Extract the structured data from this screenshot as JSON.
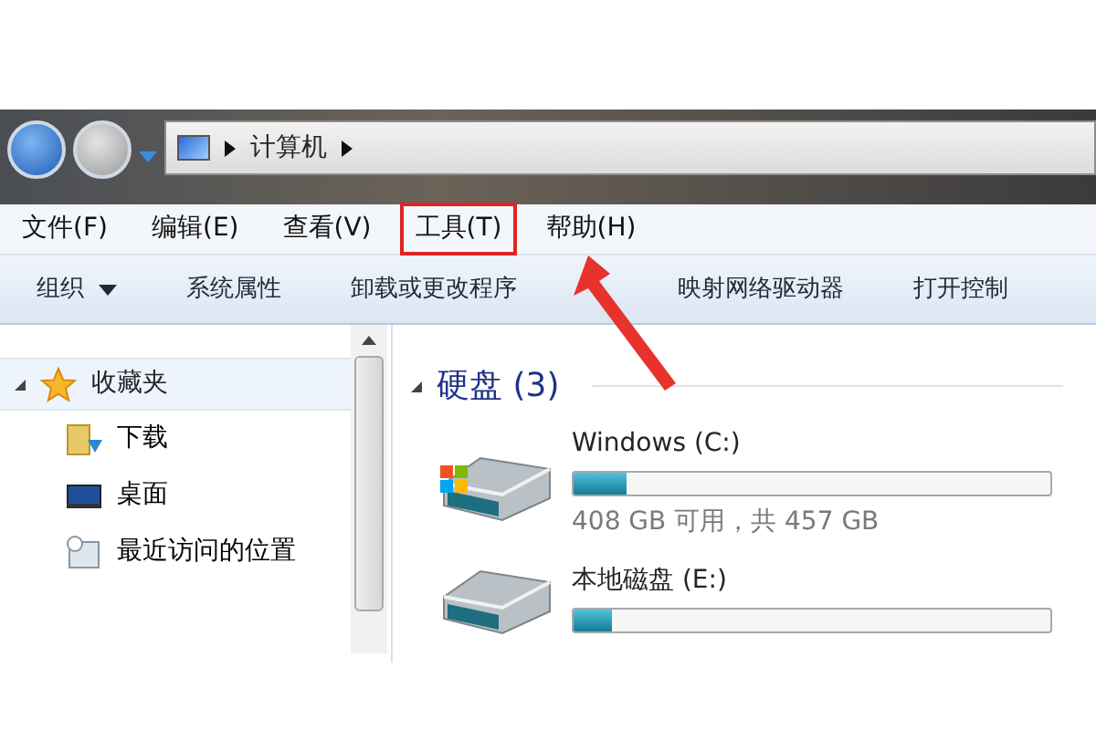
{
  "address_bar": {
    "crumbs": [
      "计算机"
    ]
  },
  "menu": [
    {
      "label": "文件(F)",
      "highlighted": false
    },
    {
      "label": "编辑(E)",
      "highlighted": false
    },
    {
      "label": "查看(V)",
      "highlighted": false
    },
    {
      "label": "工具(T)",
      "highlighted": true
    },
    {
      "label": "帮助(H)",
      "highlighted": false
    }
  ],
  "toolbar": [
    {
      "label": "组织",
      "dropdown": true
    },
    {
      "label": "系统属性",
      "dropdown": false
    },
    {
      "label": "卸载或更改程序",
      "dropdown": false
    },
    {
      "label": "映射网络驱动器",
      "dropdown": false
    },
    {
      "label": "打开控制",
      "dropdown": false
    }
  ],
  "sidebar": {
    "header": {
      "label": "收藏夹",
      "expanded": true
    },
    "items": [
      {
        "label": "下载",
        "kind": "download"
      },
      {
        "label": "桌面",
        "kind": "desktop"
      },
      {
        "label": "最近访问的位置",
        "kind": "recent"
      }
    ]
  },
  "group": {
    "title": "硬盘 (3)",
    "expanded": true
  },
  "drives": [
    {
      "name": "Windows  (C:)",
      "level": 0.11,
      "info": "408 GB 可用，共 457 GB"
    },
    {
      "name": "本地磁盘 (E:)",
      "level": 0.08
    }
  ]
}
